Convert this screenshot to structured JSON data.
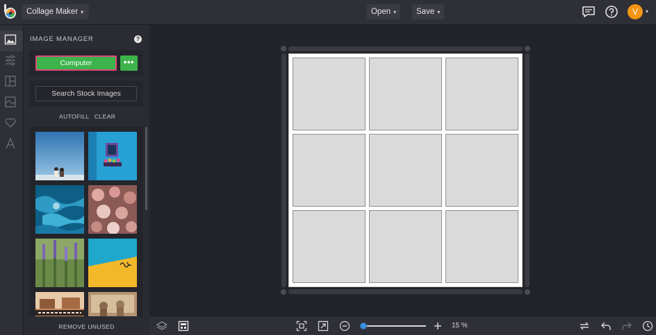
{
  "topbar": {
    "app_name": "Collage Maker",
    "chevron": "▾",
    "open_label": "Open",
    "save_label": "Save",
    "icons": [
      "chat-icon",
      "help-icon"
    ],
    "avatar_initial": "V",
    "avatar_color": "#f29512"
  },
  "rail": {
    "items": [
      "image-icon",
      "sliders-icon",
      "layout-icon",
      "background-icon",
      "heart-icon",
      "text-icon"
    ],
    "active": "image-icon"
  },
  "image_manager": {
    "title": "IMAGE MANAGER",
    "help_glyph": "?",
    "computer_label": "Computer",
    "more_label": "•••",
    "stock_label": "Search Stock Images",
    "autofill_label": "AUTOFILL",
    "clear_label": "CLEAR",
    "remove_unused_label": "REMOVE UNUSED",
    "thumbnails": [
      "couple-on-sky",
      "blue-wall-window-flowers",
      "ocean-waves",
      "pink-roses",
      "lavender-field",
      "yellow-blue-wall",
      "restaurant-sign",
      "sepia-street"
    ]
  },
  "colors": {
    "accent_green": "#3cb44b",
    "highlight_border": "#e0457b",
    "zoom_blue": "#3d8fe0"
  },
  "collage": {
    "rows": 3,
    "columns": 3
  },
  "bottombar": {
    "icons": [
      "layers-icon",
      "template-icon",
      "fit-screen-icon",
      "expand-icon",
      "zoom-out-icon",
      "zoom-in-icon",
      "swap-icon",
      "undo-icon",
      "redo-icon",
      "history-icon"
    ],
    "zoom_label": "15 %",
    "zoom_level": 0.05
  }
}
